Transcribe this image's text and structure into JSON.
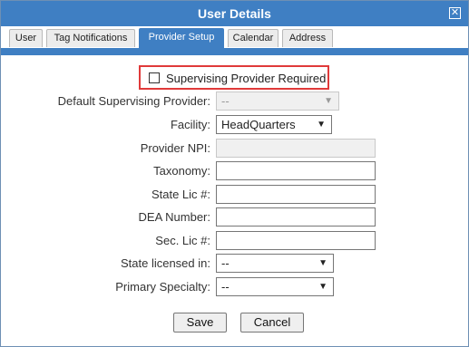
{
  "window": {
    "title": "User Details",
    "close_glyph": "✕"
  },
  "tabs": [
    {
      "label": "User",
      "active": false
    },
    {
      "label": "Tag Notifications",
      "active": false
    },
    {
      "label": "Provider Setup",
      "active": true
    },
    {
      "label": "Calendar",
      "active": false
    },
    {
      "label": "Address",
      "active": false
    }
  ],
  "form": {
    "supervising_required_label": "Supervising Provider Required",
    "supervising_required_checked": false,
    "default_supervising_label": "Default Supervising Provider:",
    "default_supervising_value": "--",
    "facility_label": "Facility:",
    "facility_value": "HeadQuarters",
    "npi_label": "Provider NPI:",
    "npi_value": "",
    "taxonomy_label": "Taxonomy:",
    "taxonomy_value": "",
    "state_lic_label": "State Lic #:",
    "state_lic_value": "",
    "dea_label": "DEA Number:",
    "dea_value": "",
    "sec_lic_label": "Sec. Lic #:",
    "sec_lic_value": "",
    "state_licensed_label": "State licensed in:",
    "state_licensed_value": "--",
    "primary_specialty_label": "Primary Specialty:",
    "primary_specialty_value": "--"
  },
  "buttons": {
    "save_label": "Save",
    "cancel_label": "Cancel"
  },
  "colors": {
    "header": "#3f7fc3",
    "highlight": "#e03a3a"
  }
}
